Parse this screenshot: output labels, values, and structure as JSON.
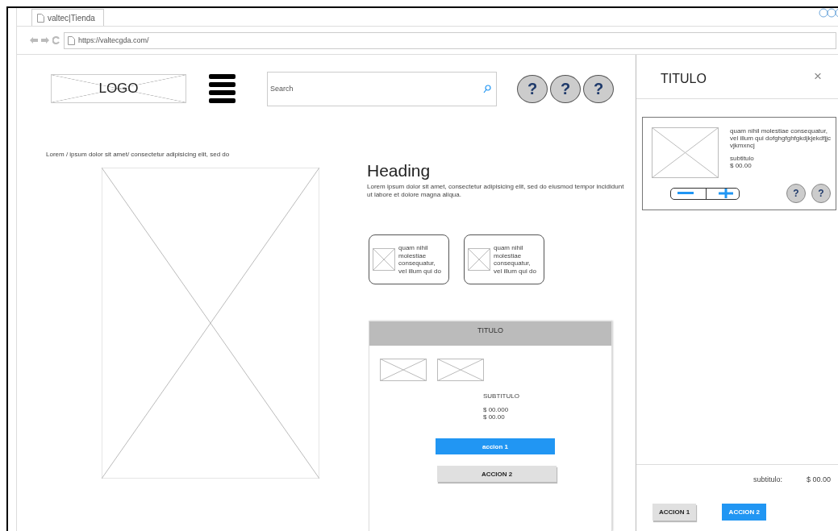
{
  "browser": {
    "tab_title": "valtec|Tienda",
    "url": "https://valtecgda.com/"
  },
  "header": {
    "logo": "LOGO",
    "search": {
      "placeholder": "Search"
    },
    "help_buttons": [
      "?",
      "?",
      "?"
    ]
  },
  "intro_text": "Lorem / ipsum dolor sit amet/ consectetur adipisicing elit, sed do",
  "heading": "Heading",
  "paragraph": "Lorem ipsum dolor sit amet, consectetur adipisicing elit, sed do eiusmod tempor incididunt ut labore et dolore magna aliqua.",
  "mini_cards": [
    {
      "text": "quam nihil molestiae consequatur, vel illum qui do"
    },
    {
      "text": "quam nihil molestiae consequatur, vel illum qui do"
    }
  ],
  "product_panel": {
    "title": "TITULO",
    "subtitle": "SUBTITULO",
    "prices": [
      "$ 00.000",
      "$ 00.00"
    ],
    "buttons": [
      {
        "label": "accion 1",
        "kind": "primary"
      },
      {
        "label": "ACCION 2",
        "kind": "secondary"
      }
    ]
  },
  "drawer": {
    "title": "TITULO",
    "close": "×",
    "item": {
      "text": "quam nihil molestiae consequatur, vel illum qui dofghgfghfgkdjkjekdfjjcvjkmxncj",
      "subtitle": "subtitulo",
      "price": "$ 00.00",
      "help_buttons": [
        "?",
        "?"
      ]
    },
    "total_label": "subtitulo:",
    "total": "$ 00.00",
    "buttons": [
      {
        "label": "ACCION 1",
        "kind": "secondary"
      },
      {
        "label": "ACCION 2",
        "kind": "primary"
      }
    ]
  }
}
